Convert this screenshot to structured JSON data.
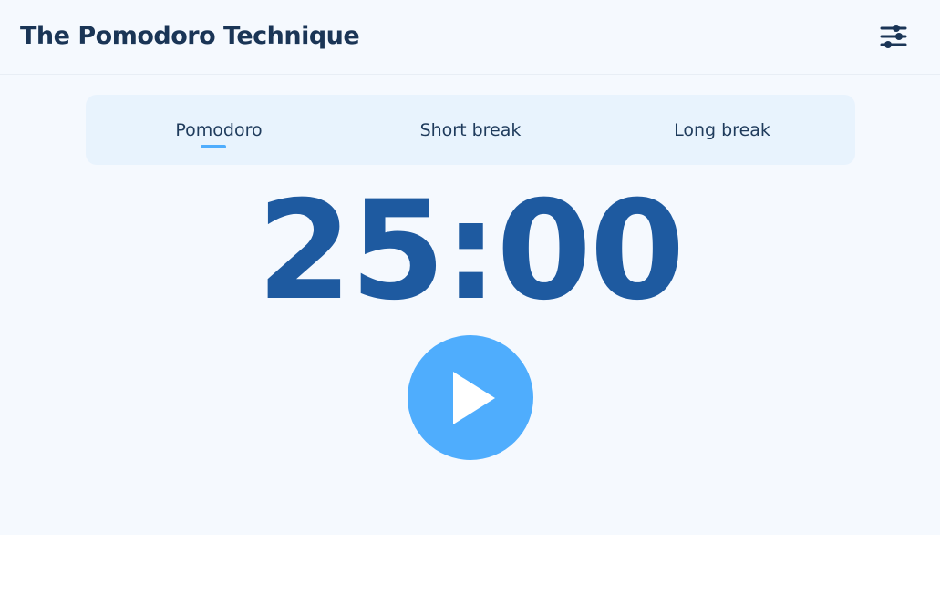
{
  "header": {
    "title": "The Pomodoro Technique",
    "settings_icon": "sliders-icon"
  },
  "tabs": [
    {
      "label": "Pomodoro",
      "active": true
    },
    {
      "label": "Short break",
      "active": false
    },
    {
      "label": "Long break",
      "active": false
    }
  ],
  "timer": {
    "display": "25:00"
  },
  "controls": {
    "play_icon": "play-icon"
  },
  "colors": {
    "background": "#f5f9fe",
    "title": "#1a3556",
    "tab_panel": "#e8f3fd",
    "timer": "#1e5aa0",
    "accent": "#4fadfd"
  }
}
